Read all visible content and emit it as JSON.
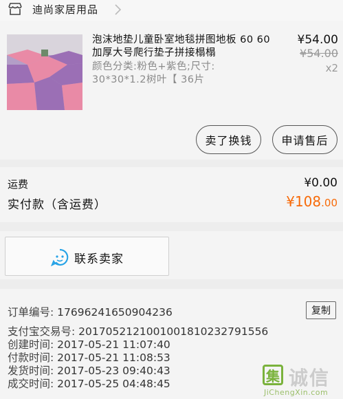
{
  "shop": {
    "name": "迪尚家居用品",
    "icon": "store-icon"
  },
  "product": {
    "title": "泡沫地垫儿童卧室地毯拼图地板 60 60加厚大号爬行垫子拼接榻榻",
    "sku": "颜色分类:粉色+紫色;尺寸: 30*30*1.2树叶【 36片",
    "price": "¥54.00",
    "original_price": "¥54.00",
    "quantity": "x2",
    "image_colors": {
      "pink": "#e98aa6",
      "purple": "#9b6fb5"
    }
  },
  "actions": {
    "sell": "卖了换钱",
    "refund": "申请售后"
  },
  "totals": {
    "shipping_label": "运费",
    "shipping_value": "¥0.00",
    "paid_label": "实付款（含运费）",
    "paid_currency": "¥",
    "paid_main": "108",
    "paid_cents": ".00",
    "paid_color": "#f76a08"
  },
  "contact": {
    "label": "联系卖家",
    "icon": "chat-bubble-icon"
  },
  "order_info": {
    "copy_label": "复制",
    "rows": [
      {
        "key": "订单编号:",
        "value": "17696241650904236"
      },
      {
        "key": "支付宝交易号:",
        "value": "2017052121001001810232791556"
      },
      {
        "key": "创建时间:",
        "value": "2017-05-21 11:07:40"
      },
      {
        "key": "付款时间:",
        "value": "2017-05-21 11:08:53"
      },
      {
        "key": "发货时间:",
        "value": "2017-05-23 09:40:43"
      },
      {
        "key": "成交时间:",
        "value": "2017-05-25 04:48:45"
      }
    ]
  },
  "watermark": {
    "logo_char": "集",
    "text": "诚信",
    "url": "JiChengXin.com"
  }
}
